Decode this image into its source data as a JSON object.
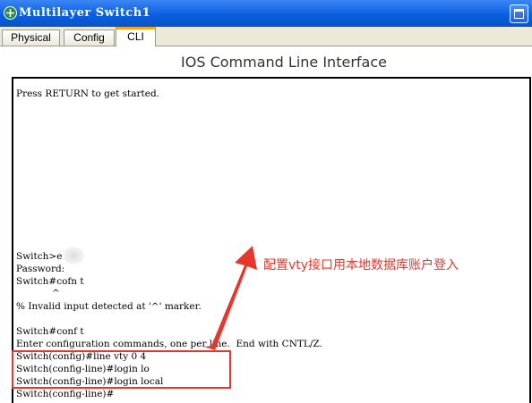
{
  "window": {
    "title": "Multilayer Switch1",
    "icon": "switch-icon",
    "control": "maximize-icon"
  },
  "tabs": [
    {
      "label": "Physical",
      "active": false
    },
    {
      "label": "Config",
      "active": false
    },
    {
      "label": "CLI",
      "active": true
    }
  ],
  "cli": {
    "heading": "IOS Command Line Interface",
    "lines": [
      "Press RETURN to get started.",
      "Switch>e",
      "Password:",
      "Switch#cofn t",
      "            ^",
      "% Invalid input detected at '^' marker.",
      "Switch#conf t",
      "Enter configuration commands, one per line.  End with CNTL/Z.",
      "Switch(config)#line vty 0 4",
      "Switch(config-line)#login lo",
      "Switch(config-line)#login local",
      "Switch(config-line)#"
    ]
  },
  "annotation": {
    "text": "配置vty接口用本地数据库账户登入",
    "color": "#e8362c"
  },
  "colors": {
    "titlebar": "#0a5fe0",
    "active_tab_accent": "#f5a623"
  }
}
